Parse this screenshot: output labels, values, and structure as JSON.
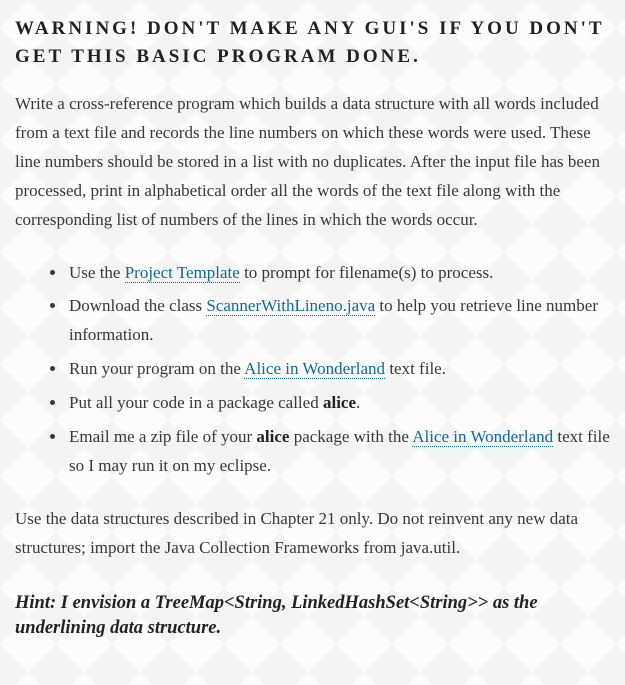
{
  "heading": "WARNING! DON'T MAKE ANY GUI'S IF YOU DON'T GET THIS BASIC PROGRAM DONE.",
  "intro": "Write a cross-reference program which builds a data structure with all words included from a text file and records the line numbers on which these words were used.   These line numbers should be stored in a list with no duplicates.  After the input file has been processed, print in alphabetical order all the words of the text file along with the corresponding list of numbers of the lines in which the words occur.",
  "bullets": {
    "b1_pre": "Use the ",
    "b1_link": "Project Template",
    "b1_post": " to prompt for filename(s) to process.",
    "b2_pre": "Download the class ",
    "b2_link": "ScannerWithLineno.java",
    "b2_post": " to help you retrieve line number information.",
    "b3_pre": "Run your program on the ",
    "b3_link": "Alice in Wonderland",
    "b3_post": " text file.",
    "b4_pre": "Put all your code in a package called ",
    "b4_strong": "alice",
    "b4_post": ".",
    "b5_pre": "Email me a zip file of your ",
    "b5_strong": "alice",
    "b5_mid": " package with the ",
    "b5_link": "Alice in Wonderland",
    "b5_post": " text file so I may run it on my eclipse."
  },
  "closing": "Use the data structures described in Chapter 21 only.  Do not reinvent any new data structures; import the Java Collection Frameworks from java.util.",
  "hint": "Hint: I envision a TreeMap<String, LinkedHashSet<String>> as the underlining data structure."
}
